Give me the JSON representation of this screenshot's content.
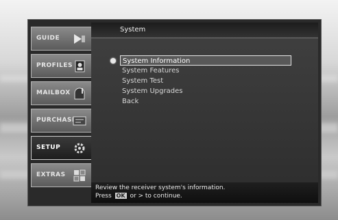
{
  "sidebar": {
    "tabs": [
      {
        "label": "GUIDE",
        "icon": "arrow-right-icon"
      },
      {
        "label": "PROFILES",
        "icon": "profile-icon"
      },
      {
        "label": "MAILBOX",
        "icon": "mailbox-icon"
      },
      {
        "label": "PURCHASES",
        "icon": "purchase-icon"
      },
      {
        "label": "SETUP",
        "icon": "setup-icon",
        "active": true
      },
      {
        "label": "EXTRAS",
        "icon": "extras-icon"
      }
    ]
  },
  "panel": {
    "title": "System",
    "menu": [
      "System Information",
      "System Features",
      "System Test",
      "System Upgrades",
      "Back"
    ],
    "selected_index": 0
  },
  "help": {
    "line1": "Review the receiver system's information.",
    "line2_prefix": "Press",
    "ok_key": "OK",
    "line2_suffix": "or > to continue."
  }
}
